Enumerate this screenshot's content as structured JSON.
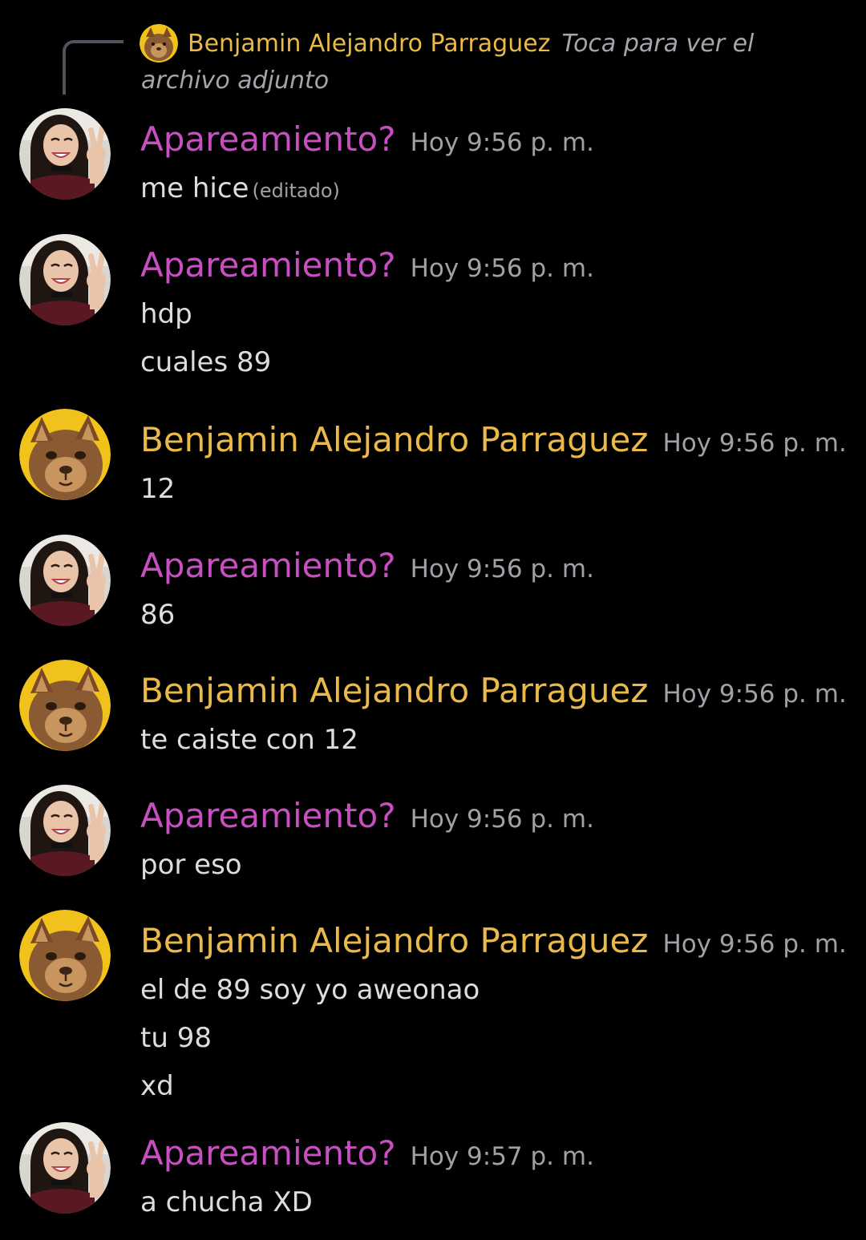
{
  "reply": {
    "author": "Benjamin Alejandro Parraguez",
    "hint": "Toca para ver el archivo adjunto"
  },
  "messages": [
    {
      "author": "Apareamiento?",
      "avatar": "girl-avatar",
      "time": "Hoy 9:56 p. m.",
      "lines": [
        "me hice"
      ],
      "edited": "(editado)"
    },
    {
      "author": "Apareamiento?",
      "avatar": "girl-avatar",
      "time": "Hoy 9:56 p. m.",
      "lines": [
        "hdp",
        "cuales 89"
      ]
    },
    {
      "author": "Benjamin Alejandro Parraguez",
      "avatar": "cat-avatar",
      "time": "Hoy 9:56 p. m.",
      "lines": [
        "12"
      ]
    },
    {
      "author": "Apareamiento?",
      "avatar": "girl-avatar",
      "time": "Hoy 9:56 p. m.",
      "lines": [
        "86"
      ]
    },
    {
      "author": "Benjamin Alejandro Parraguez",
      "avatar": "cat-avatar",
      "time": "Hoy 9:56 p. m.",
      "lines": [
        "te caiste con 12"
      ]
    },
    {
      "author": "Apareamiento?",
      "avatar": "girl-avatar",
      "time": "Hoy 9:56 p. m.",
      "lines": [
        "por eso"
      ]
    },
    {
      "author": "Benjamin Alejandro Parraguez",
      "avatar": "cat-avatar",
      "time": "Hoy 9:56 p. m.",
      "lines": [
        "el de 89 soy yo aweonao",
        "tu 98",
        "xd"
      ]
    },
    {
      "author": "Apareamiento?",
      "avatar": "girl-avatar",
      "time": "Hoy 9:57 p. m.",
      "lines": [
        "a chucha XD"
      ]
    }
  ],
  "colors": {
    "background": "#000000",
    "girl_name": "#c84fc1",
    "cat_name": "#e9b949",
    "timestamp": "#9ea1a6",
    "message_text": "#dcddde"
  }
}
